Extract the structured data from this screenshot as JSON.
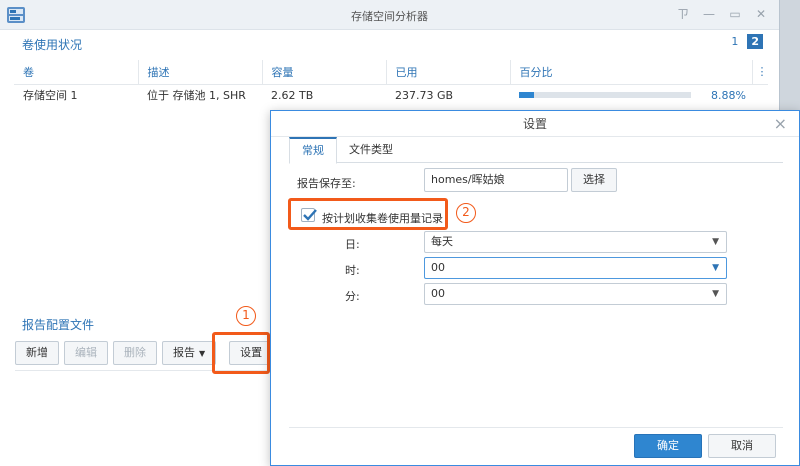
{
  "window": {
    "title": "存储空间分析器",
    "controls": {
      "pin": "ㄗ",
      "minimize": "—",
      "maximize": "▭",
      "close": "✕"
    }
  },
  "volume_section": {
    "title": "卷使用状况",
    "pages": [
      "1",
      "2"
    ],
    "active_page": "2",
    "columns": [
      "卷",
      "描述",
      "容量",
      "已用",
      "百分比"
    ],
    "rows": [
      {
        "volume": "存储空间 1",
        "description": "位于 存储池 1, SHR",
        "capacity": "2.62 TB",
        "used": "237.73 GB",
        "percent": "8.88%",
        "percent_value": 8.88
      }
    ],
    "more_icon": "⋮"
  },
  "report_section": {
    "title": "报告配置文件",
    "buttons": {
      "new": "新增",
      "edit": "编辑",
      "delete": "删除",
      "report": "报告",
      "settings": "设置"
    }
  },
  "annotations": {
    "one": "1",
    "two": "2"
  },
  "dialog": {
    "title": "设置",
    "tabs": [
      "常规",
      "文件类型"
    ],
    "save_label": "报告保存至:",
    "save_path": "homes/晖姑娘",
    "browse_button": "选择",
    "schedule_checkbox": "按计划收集卷使用量记录",
    "schedule_checked": true,
    "day_label": "日:",
    "day_value": "每天",
    "hour_label": "时:",
    "hour_value": "00",
    "minute_label": "分:",
    "minute_value": "00",
    "ok_button": "确定",
    "cancel_button": "取消"
  },
  "colors": {
    "accent": "#2e74b5",
    "primary_button": "#2f86d0",
    "highlight": "#f25a1a"
  }
}
